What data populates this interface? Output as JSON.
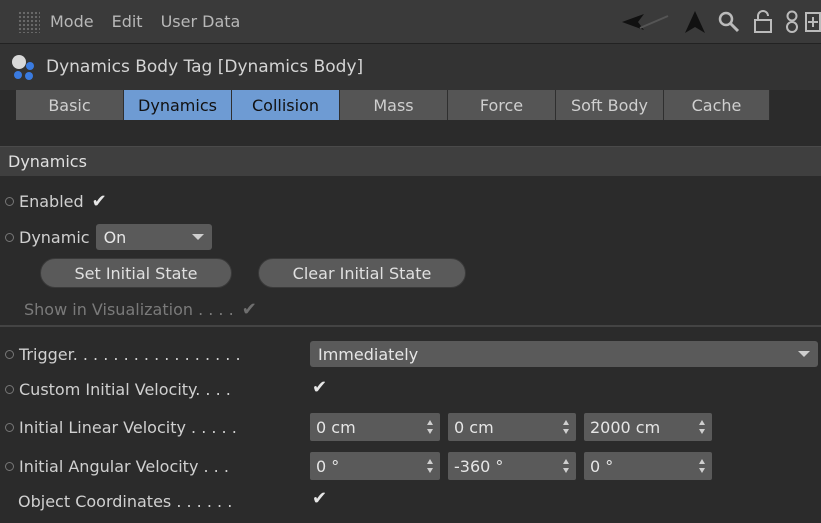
{
  "menubar": {
    "items": [
      "Mode",
      "Edit",
      "User Data"
    ]
  },
  "title": {
    "text": "Dynamics Body Tag [Dynamics Body]"
  },
  "tabs": [
    {
      "label": "Basic",
      "active": false
    },
    {
      "label": "Dynamics",
      "active": true
    },
    {
      "label": "Collision",
      "active": true
    },
    {
      "label": "Mass",
      "active": false
    },
    {
      "label": "Force",
      "active": false
    },
    {
      "label": "Soft Body",
      "active": false
    },
    {
      "label": "Cache",
      "active": false
    }
  ],
  "section": {
    "title": "Dynamics"
  },
  "enabled": {
    "label": "Enabled",
    "checked": true
  },
  "dynamic": {
    "label": "Dynamic",
    "value": "On"
  },
  "buttons": {
    "set_initial": "Set Initial State",
    "clear_initial": "Clear Initial State"
  },
  "show_vis": {
    "label": "Show in Visualization . . . .",
    "checked": true
  },
  "trigger": {
    "label": "Trigger. . . . . . . . . . . . . . . . .",
    "value": "Immediately"
  },
  "custom_velocity": {
    "label": "Custom Initial Velocity. . . .",
    "checked": true
  },
  "linear": {
    "label": "Initial Linear Velocity . . . . .",
    "x": "0 cm",
    "y": "0 cm",
    "z": "2000 cm"
  },
  "angular": {
    "label": "Initial Angular Velocity . . .",
    "x": "0 °",
    "y": "-360 °",
    "z": "0 °"
  },
  "object_coords": {
    "label": "Object Coordinates . . . . . .",
    "checked": true
  },
  "colors": {
    "accent": "#6e9bd3",
    "panel": "#2b2b2b",
    "field": "#5a5a5a"
  }
}
